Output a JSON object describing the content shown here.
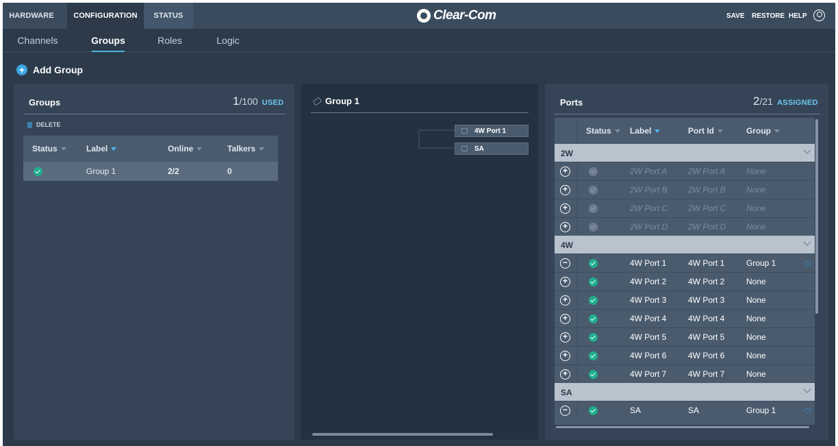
{
  "topbar": {
    "tabs": [
      {
        "label": "HARDWARE",
        "active": false
      },
      {
        "label": "CONFIGURATION",
        "active": true
      },
      {
        "label": "STATUS",
        "active": false
      }
    ],
    "logo_text": "Clear-Com",
    "actions": {
      "save": "SAVE",
      "restore": "RESTORE",
      "help": "HELP"
    }
  },
  "subnav": {
    "tabs": [
      {
        "label": "Channels",
        "active": false
      },
      {
        "label": "Groups",
        "active": true
      },
      {
        "label": "Roles",
        "active": false
      },
      {
        "label": "Logic",
        "active": false
      }
    ]
  },
  "add_group_label": "Add Group",
  "groups_panel": {
    "title": "Groups",
    "used_count": "1",
    "used_total": "/100",
    "used_tag": "USED",
    "delete_label": "DELETE",
    "columns": [
      "Status",
      "Label",
      "Online",
      "Talkers"
    ],
    "rows": [
      {
        "status": "online",
        "label": "Group 1",
        "online": "2/2",
        "talkers": "0"
      }
    ]
  },
  "canvas_panel": {
    "title": "Group 1",
    "nodes": [
      "4W Port 1",
      "SA"
    ]
  },
  "ports_panel": {
    "title": "Ports",
    "assigned_count": "2",
    "assigned_total": "/21",
    "assigned_tag": "ASSIGNED",
    "columns": [
      "Status",
      "Label",
      "Port Id",
      "Group"
    ],
    "categories": [
      {
        "name": "2W",
        "rows": [
          {
            "action": "+",
            "label": "2W Port A",
            "port_id": "2W Port A",
            "group": "None",
            "dim": true
          },
          {
            "action": "+",
            "label": "2W Port B",
            "port_id": "2W Port B",
            "group": "None",
            "dim": true
          },
          {
            "action": "+",
            "label": "2W Port C",
            "port_id": "2W Port C",
            "group": "None",
            "dim": true
          },
          {
            "action": "+",
            "label": "2W Port D",
            "port_id": "2W Port D",
            "group": "None",
            "dim": true
          }
        ]
      },
      {
        "name": "4W",
        "rows": [
          {
            "action": "−",
            "label": "4W Port 1",
            "port_id": "4W Port 1",
            "group": "Group 1",
            "dim": false
          },
          {
            "action": "+",
            "label": "4W Port 2",
            "port_id": "4W Port 2",
            "group": "None",
            "dim": false
          },
          {
            "action": "+",
            "label": "4W Port 3",
            "port_id": "4W Port 3",
            "group": "None",
            "dim": false
          },
          {
            "action": "+",
            "label": "4W Port 4",
            "port_id": "4W Port 4",
            "group": "None",
            "dim": false
          },
          {
            "action": "+",
            "label": "4W Port 5",
            "port_id": "4W Port 5",
            "group": "None",
            "dim": false
          },
          {
            "action": "+",
            "label": "4W Port 6",
            "port_id": "4W Port 6",
            "group": "None",
            "dim": false
          },
          {
            "action": "+",
            "label": "4W Port 7",
            "port_id": "4W Port 7",
            "group": "None",
            "dim": false
          }
        ]
      },
      {
        "name": "SA",
        "rows": [
          {
            "action": "−",
            "label": "SA",
            "port_id": "SA",
            "group": "Group 1",
            "dim": false
          }
        ]
      }
    ]
  },
  "colors": {
    "accent": "#4fb3e8",
    "status_ok": "#1fae8e",
    "background": "#2c3a4a"
  }
}
